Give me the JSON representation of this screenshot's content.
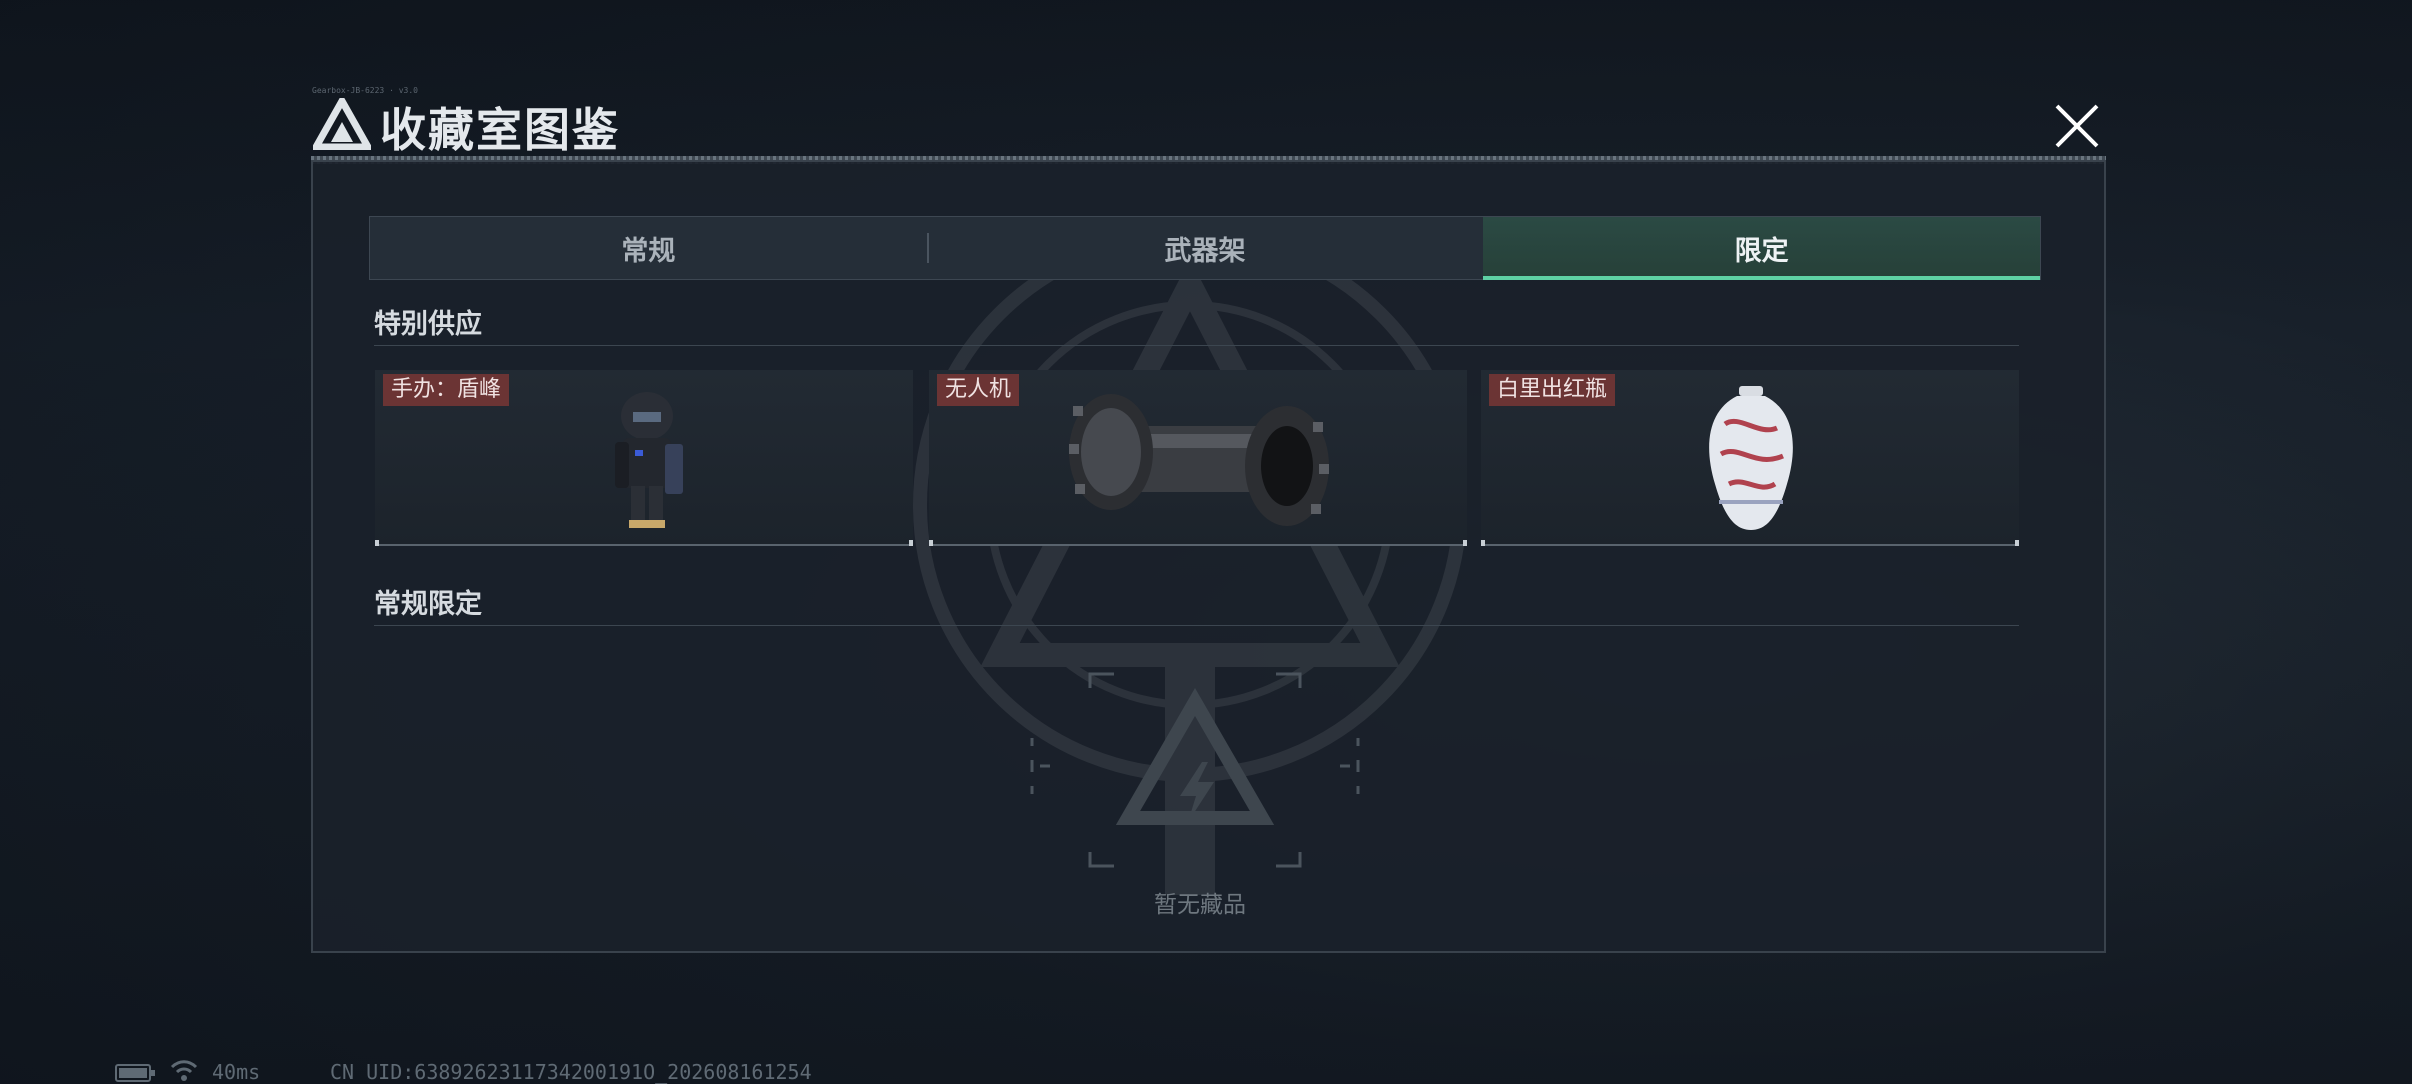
{
  "header": {
    "title": "收藏室图鉴",
    "small_label": "Gearbox-JB-6223 · v3.0"
  },
  "tabs": [
    {
      "label": "常规",
      "active": false
    },
    {
      "label": "武器架",
      "active": false
    },
    {
      "label": "限定",
      "active": true
    }
  ],
  "sections": {
    "special": {
      "title": "特别供应",
      "items": [
        {
          "tag": "手办：盾峰",
          "icon": "shield-soldier-figure-icon"
        },
        {
          "tag": "无人机",
          "icon": "drone-roller-icon"
        },
        {
          "tag": "白里出红瓶",
          "icon": "porcelain-vase-icon"
        }
      ]
    },
    "regular_limited": {
      "title": "常规限定",
      "empty_text": "暂无藏品"
    }
  },
  "status_bar": {
    "ping": "40ms",
    "uid": "CN UID:6389262311734200191O_202608161254"
  },
  "colors": {
    "accent": "#5ed1a4",
    "tag_bg": "#6b3434",
    "panel_bg": "#1a212a"
  }
}
